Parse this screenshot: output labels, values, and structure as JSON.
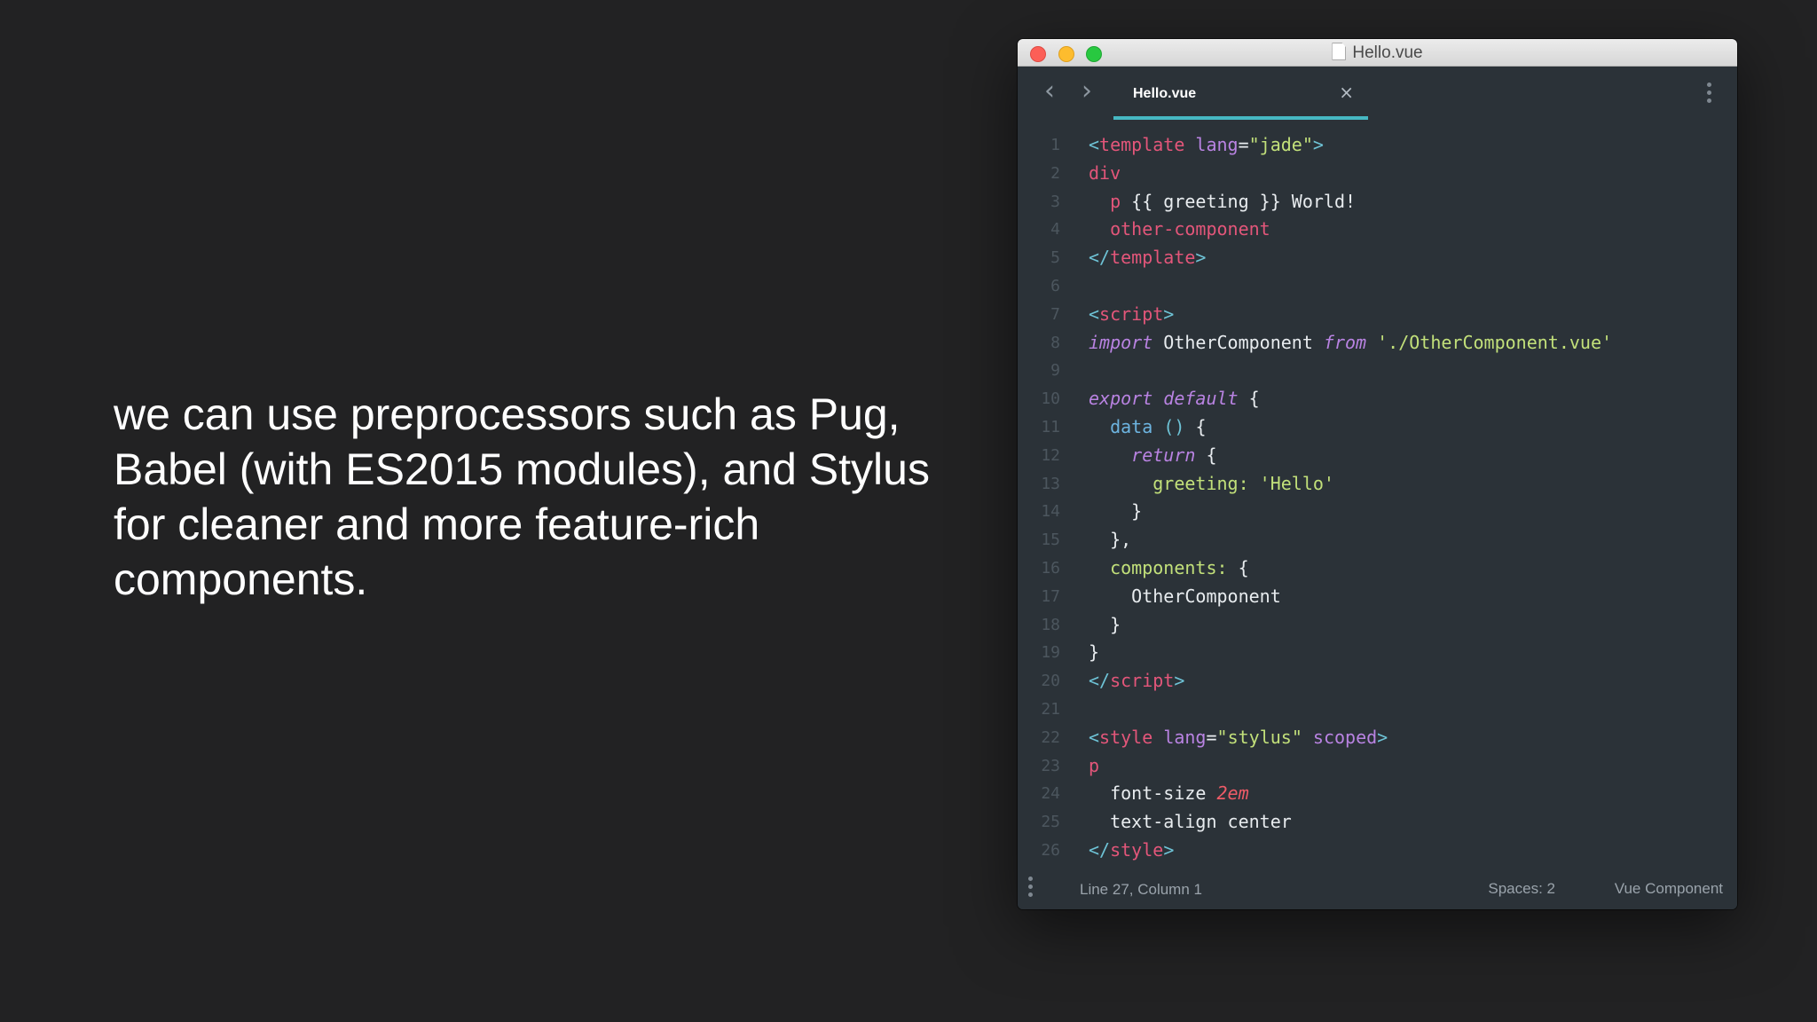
{
  "slide": {
    "text": "we can use preprocessors such as Pug, Babel (with ES2015 modules), and Stylus for cleaner and more feature-rich components."
  },
  "window": {
    "title": "Hello.vue",
    "tab_label": "Hello.vue",
    "tab_close_icon": "×",
    "nav_back_icon": "‹",
    "nav_forward_icon": "›"
  },
  "code_lines": [
    {
      "n": "1",
      "tokens": [
        [
          "k-punc",
          "<"
        ],
        [
          "k-tag",
          "template"
        ],
        [
          "k-plain",
          " "
        ],
        [
          "k-attr",
          "lang"
        ],
        [
          "k-plain",
          "="
        ],
        [
          "k-str",
          "\"jade\""
        ],
        [
          "k-punc",
          ">"
        ]
      ]
    },
    {
      "n": "2",
      "tokens": [
        [
          "k-tag",
          "div"
        ]
      ]
    },
    {
      "n": "3",
      "tokens": [
        [
          "k-plain",
          "  "
        ],
        [
          "k-tag",
          "p"
        ],
        [
          "k-plain",
          " {{ greeting }} World!"
        ]
      ]
    },
    {
      "n": "4",
      "tokens": [
        [
          "k-plain",
          "  "
        ],
        [
          "k-tag",
          "other-component"
        ]
      ]
    },
    {
      "n": "5",
      "tokens": [
        [
          "k-punc",
          "</"
        ],
        [
          "k-tag",
          "template"
        ],
        [
          "k-punc",
          ">"
        ]
      ]
    },
    {
      "n": "6",
      "tokens": []
    },
    {
      "n": "7",
      "tokens": [
        [
          "k-punc",
          "<"
        ],
        [
          "k-tag",
          "script"
        ],
        [
          "k-punc",
          ">"
        ]
      ]
    },
    {
      "n": "8",
      "tokens": [
        [
          "k-kw",
          "import"
        ],
        [
          "k-plain",
          " OtherComponent "
        ],
        [
          "k-kw",
          "from"
        ],
        [
          "k-plain",
          " "
        ],
        [
          "k-str",
          "'./OtherComponent.vue'"
        ]
      ]
    },
    {
      "n": "9",
      "tokens": []
    },
    {
      "n": "10",
      "tokens": [
        [
          "k-kw",
          "export"
        ],
        [
          "k-plain",
          " "
        ],
        [
          "k-kw",
          "default"
        ],
        [
          "k-plain",
          " {"
        ]
      ]
    },
    {
      "n": "11",
      "tokens": [
        [
          "k-plain",
          "  "
        ],
        [
          "k-fn",
          "data"
        ],
        [
          "k-plain",
          " "
        ],
        [
          "k-punc",
          "()"
        ],
        [
          "k-plain",
          " {"
        ]
      ]
    },
    {
      "n": "12",
      "tokens": [
        [
          "k-plain",
          "    "
        ],
        [
          "k-kw",
          "return"
        ],
        [
          "k-plain",
          " {"
        ]
      ]
    },
    {
      "n": "13",
      "tokens": [
        [
          "k-plain",
          "      "
        ],
        [
          "k-prop",
          "greeting:"
        ],
        [
          "k-plain",
          " "
        ],
        [
          "k-str",
          "'Hello'"
        ]
      ]
    },
    {
      "n": "14",
      "tokens": [
        [
          "k-plain",
          "    }"
        ]
      ]
    },
    {
      "n": "15",
      "tokens": [
        [
          "k-plain",
          "  },"
        ]
      ]
    },
    {
      "n": "16",
      "tokens": [
        [
          "k-plain",
          "  "
        ],
        [
          "k-prop",
          "components:"
        ],
        [
          "k-plain",
          " {"
        ]
      ]
    },
    {
      "n": "17",
      "tokens": [
        [
          "k-plain",
          "    OtherComponent"
        ]
      ]
    },
    {
      "n": "18",
      "tokens": [
        [
          "k-plain",
          "  }"
        ]
      ]
    },
    {
      "n": "19",
      "tokens": [
        [
          "k-plain",
          "}"
        ]
      ]
    },
    {
      "n": "20",
      "tokens": [
        [
          "k-punc",
          "</"
        ],
        [
          "k-tag",
          "script"
        ],
        [
          "k-punc",
          ">"
        ]
      ]
    },
    {
      "n": "21",
      "tokens": []
    },
    {
      "n": "22",
      "tokens": [
        [
          "k-punc",
          "<"
        ],
        [
          "k-tag",
          "style"
        ],
        [
          "k-plain",
          " "
        ],
        [
          "k-attr",
          "lang"
        ],
        [
          "k-plain",
          "="
        ],
        [
          "k-str",
          "\"stylus\""
        ],
        [
          "k-plain",
          " "
        ],
        [
          "k-attr",
          "scoped"
        ],
        [
          "k-punc",
          ">"
        ]
      ]
    },
    {
      "n": "23",
      "tokens": [
        [
          "k-tag",
          "p"
        ]
      ]
    },
    {
      "n": "24",
      "tokens": [
        [
          "k-plain",
          "  font-size "
        ],
        [
          "k-num",
          "2em"
        ]
      ]
    },
    {
      "n": "25",
      "tokens": [
        [
          "k-plain",
          "  text-align center"
        ]
      ]
    },
    {
      "n": "26",
      "tokens": [
        [
          "k-punc",
          "</"
        ],
        [
          "k-tag",
          "style"
        ],
        [
          "k-punc",
          ">"
        ]
      ]
    }
  ],
  "status": {
    "position": "Line 27, Column 1",
    "spaces": "Spaces: 2",
    "syntax": "Vue Component"
  },
  "colors": {
    "background": "#222223",
    "editor_bg": "#2b3238",
    "tab_underline": "#46b8c3",
    "tag": "#e3567a",
    "string": "#c2e07a",
    "keyword": "#b983e2"
  },
  "icons": [
    "close-dot-icon",
    "minimize-dot-icon",
    "maximize-dot-icon",
    "document-icon",
    "chevron-left-icon",
    "chevron-right-icon",
    "close-icon",
    "more-vertical-icon"
  ]
}
